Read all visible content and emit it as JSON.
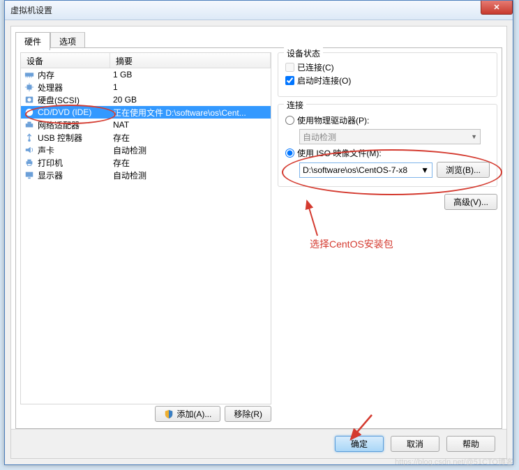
{
  "title": "虚拟机设置",
  "tabs": {
    "hardware": "硬件",
    "options": "选项"
  },
  "list": {
    "headers": {
      "device": "设备",
      "summary": "摘要"
    },
    "rows": [
      {
        "device": "内存",
        "summary": "1 GB",
        "icon": "memory"
      },
      {
        "device": "处理器",
        "summary": "1",
        "icon": "cpu"
      },
      {
        "device": "硬盘(SCSI)",
        "summary": "20 GB",
        "icon": "disk"
      },
      {
        "device": "CD/DVD (IDE)",
        "summary": "正在使用文件 D:\\software\\os\\Cent...",
        "icon": "cd",
        "selected": true
      },
      {
        "device": "网络适配器",
        "summary": "NAT",
        "icon": "net"
      },
      {
        "device": "USB 控制器",
        "summary": "存在",
        "icon": "usb"
      },
      {
        "device": "声卡",
        "summary": "自动检测",
        "icon": "sound"
      },
      {
        "device": "打印机",
        "summary": "存在",
        "icon": "printer"
      },
      {
        "device": "显示器",
        "summary": "自动检测",
        "icon": "display"
      }
    ]
  },
  "left_buttons": {
    "add": "添加(A)...",
    "remove": "移除(R)"
  },
  "right": {
    "status_group": "设备状态",
    "connected": "已连接(C)",
    "connect_at_poweron": "启动时连接(O)",
    "connection_group": "连接",
    "use_physical": "使用物理驱动器(P):",
    "autodetect": "自动检测",
    "use_iso": "使用 ISO 映像文件(M):",
    "iso_path": "D:\\software\\os\\CentOS-7-x8",
    "browse": "浏览(B)...",
    "advanced": "高级(V)..."
  },
  "footer": {
    "ok": "确定",
    "cancel": "取消",
    "help": "帮助"
  },
  "annotation": "选择CentOS安装包"
}
